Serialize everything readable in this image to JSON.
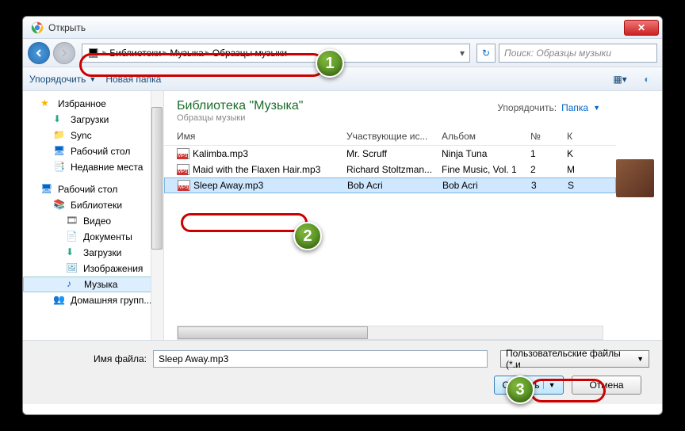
{
  "window": {
    "title": "Открыть"
  },
  "breadcrumb": {
    "items": [
      "Библиотеки",
      "Музыка",
      "Образцы музыки"
    ]
  },
  "search": {
    "placeholder": "Поиск: Образцы музыки"
  },
  "toolbar": {
    "organize": "Упорядочить",
    "newfolder": "Новая папка"
  },
  "library": {
    "title": "Библиотека \"Музыка\"",
    "subtitle": "Образцы музыки",
    "arrange_label": "Упорядочить:",
    "arrange_value": "Папка"
  },
  "columns": {
    "name": "Имя",
    "artist": "Участвующие ис...",
    "album": "Альбом",
    "no": "№",
    "next": "К"
  },
  "files": [
    {
      "name": "Kalimba.mp3",
      "artist": "Mr. Scruff",
      "album": "Ninja Tuna",
      "no": "1",
      "t": "K"
    },
    {
      "name": "Maid with the Flaxen Hair.mp3",
      "artist": "Richard Stoltzman...",
      "album": "Fine Music, Vol. 1",
      "no": "2",
      "t": "M"
    },
    {
      "name": "Sleep Away.mp3",
      "artist": "Bob Acri",
      "album": "Bob Acri",
      "no": "3",
      "t": "S"
    }
  ],
  "sidebar": {
    "fav": "Избранное",
    "dl": "Загрузки",
    "sync": "Sync",
    "desk": "Рабочий стол",
    "recent": "Недавние места",
    "desktop": "Рабочий стол",
    "libs": "Библиотеки",
    "video": "Видео",
    "docs": "Документы",
    "dl2": "Загрузки",
    "img": "Изображения",
    "music": "Музыка",
    "group": "Домашняя групп..."
  },
  "filename": {
    "label": "Имя файла:",
    "value": "Sleep Away.mp3"
  },
  "filetype": {
    "label": "Пользовательские файлы (*.и"
  },
  "buttons": {
    "open": "Открыть",
    "cancel": "Отмена"
  },
  "badges": {
    "1": "1",
    "2": "2",
    "3": "3"
  }
}
